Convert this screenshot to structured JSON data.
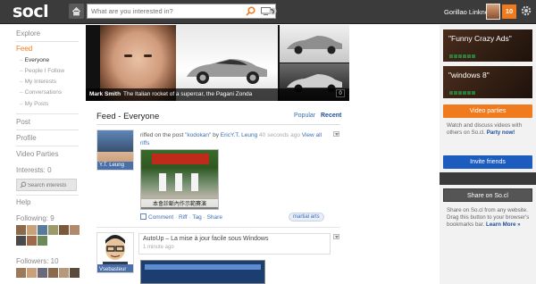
{
  "topbar": {
    "logo": "socl",
    "search_placeholder": "What are you interested in?",
    "username": "Gorillao Linknoi",
    "notification_count": "10"
  },
  "sidebar": {
    "explore": "Explore",
    "feed": "Feed",
    "feed_items": [
      "Everyone",
      "People I Follow",
      "My Interests",
      "Conversations",
      "My Posts"
    ],
    "post": "Post",
    "profile": "Profile",
    "video_parties": "Video Parties",
    "interests": "Interests: 0",
    "search_interests_placeholder": "Search interests",
    "help": "Help",
    "following": "Following: 9",
    "followers": "Followers: 10"
  },
  "hero": {
    "caption_name": "Mark Smith",
    "caption_text": "The Italian rocket of a supercar, the Pagani Zonda",
    "badge": "0"
  },
  "feed": {
    "title": "Feed - Everyone",
    "tab_popular": "Popular",
    "tab_recent": "Recent"
  },
  "post1": {
    "author": "Y.T. Leung",
    "text_before": "riffed on the post ",
    "post_link": "\"kodokan\"",
    "text_by": " by ",
    "by_user": "EricY.T. Leung",
    "time": " 40 seconds ago ",
    "view_all": "View all",
    "riffs": "riffs",
    "image_caption": "本會診斷內作示範賽演",
    "comment": "Comment",
    "riff": "Riff",
    "tag": "Tag",
    "share": "Share",
    "tag_pill": "martial arts"
  },
  "post2": {
    "author": "Vsebasteur",
    "title": "AutoUp – La mise à jour facile sous Windows",
    "time": "1 minute ago"
  },
  "rightcol": {
    "ad1": "\"Funny Crazy Ads\"",
    "ad2": "\"windows 8\"",
    "video_parties_btn": "Video parties",
    "video_text": "Watch and discuss videos with others on So.cl.",
    "party_now": "Party now!",
    "invite_btn": "Invite friends",
    "share_btn": "Share on So.cl",
    "share_text": "Share on So.cl from any website. Drag this button to your browser's bookmarks bar.",
    "learn_more": "Learn More »"
  },
  "colors": {
    "accent_orange": "#f07b1e",
    "link_blue": "#3a6fb4",
    "topbar": "#3b3b3b"
  }
}
